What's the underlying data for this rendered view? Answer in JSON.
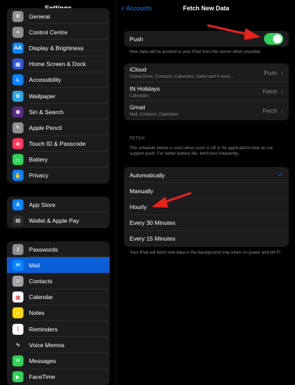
{
  "sidebar": {
    "title": "Settings",
    "group1": [
      {
        "label": "General",
        "icon": "gear-icon",
        "color": "#8e8e93",
        "glyph": "⚙"
      },
      {
        "label": "Control Centre",
        "icon": "control-centre-icon",
        "color": "#8e8e93",
        "glyph": "≡"
      },
      {
        "label": "Display & Brightness",
        "icon": "display-brightness-icon",
        "color": "#0a84ff",
        "glyph": "AA"
      },
      {
        "label": "Home Screen & Dock",
        "icon": "home-screen-icon",
        "color": "#3458d6",
        "glyph": "▦"
      },
      {
        "label": "Accessibility",
        "icon": "accessibility-icon",
        "color": "#0a84ff",
        "glyph": "♿"
      },
      {
        "label": "Wallpaper",
        "icon": "wallpaper-icon",
        "color": "#2fa3e0",
        "glyph": "✿"
      },
      {
        "label": "Siri & Search",
        "icon": "siri-icon",
        "color": "#5b2a86",
        "glyph": "◉"
      },
      {
        "label": "Apple Pencil",
        "icon": "apple-pencil-icon",
        "color": "#8e8e93",
        "glyph": "✎"
      },
      {
        "label": "Touch ID & Passcode",
        "icon": "fingerprint-icon",
        "color": "#ff375f",
        "glyph": "⊚"
      },
      {
        "label": "Battery",
        "icon": "battery-icon",
        "color": "#30d158",
        "glyph": "▭"
      },
      {
        "label": "Privacy",
        "icon": "privacy-hand-icon",
        "color": "#0a84ff",
        "glyph": "✋"
      }
    ],
    "group2": [
      {
        "label": "App Store",
        "icon": "app-store-icon",
        "color": "#0a84ff",
        "glyph": "A"
      },
      {
        "label": "Wallet & Apple Pay",
        "icon": "wallet-icon",
        "color": "#2c2c2e",
        "glyph": "▤"
      }
    ],
    "group3": [
      {
        "label": "Passwords",
        "icon": "key-icon",
        "color": "#8e8e93",
        "glyph": "⚷"
      },
      {
        "label": "Mail",
        "icon": "mail-icon",
        "color": "#0a84ff",
        "glyph": "✉",
        "active": true
      },
      {
        "label": "Contacts",
        "icon": "contacts-icon",
        "color": "#a1a1a6",
        "glyph": "☺"
      },
      {
        "label": "Calendar",
        "icon": "calendar-icon",
        "color": "#ffffff",
        "glyph": "▦"
      },
      {
        "label": "Notes",
        "icon": "notes-icon",
        "color": "#ffd60a",
        "glyph": "≡"
      },
      {
        "label": "Reminders",
        "icon": "reminders-icon",
        "color": "#ffffff",
        "glyph": "⋮"
      },
      {
        "label": "Voice Memos",
        "icon": "voice-memos-icon",
        "color": "#1c1c1e",
        "glyph": "∿"
      },
      {
        "label": "Messages",
        "icon": "messages-icon",
        "color": "#30d158",
        "glyph": "✉"
      },
      {
        "label": "FaceTime",
        "icon": "facetime-icon",
        "color": "#30d158",
        "glyph": "▶"
      }
    ]
  },
  "nav": {
    "back_label": "Accounts",
    "title": "Fetch New Data"
  },
  "push": {
    "label": "Push",
    "enabled": true,
    "footnote": "New data will be pushed to your iPad from the server when possible."
  },
  "accounts": [
    {
      "name": "iCloud",
      "sub": "iCloud Drive, Contacts, Calendars, Safari and 4 more...",
      "value": "Push"
    },
    {
      "name": "IN Holidays",
      "sub": "Calendars",
      "value": "Fetch"
    },
    {
      "name": "Gmail",
      "sub": "Mail, Contacts, Calendars",
      "value": "Fetch"
    }
  ],
  "fetch": {
    "header": "FETCH",
    "description": "The schedule below is used when push is off or for applications that do not support push. For better battery life, fetch less frequently.",
    "options": [
      {
        "label": "Automatically",
        "selected": true
      },
      {
        "label": "Manually",
        "selected": false
      },
      {
        "label": "Hourly",
        "selected": false
      },
      {
        "label": "Every 30 Minutes",
        "selected": false
      },
      {
        "label": "Every 15 Minutes",
        "selected": false
      }
    ],
    "footnote": "Your iPad will fetch new data in the background only when on power and Wi-Fi."
  },
  "colors": {
    "accent": "#0a84ff",
    "toggle_on": "#30d158",
    "annotation_arrow": "#e8231c"
  }
}
